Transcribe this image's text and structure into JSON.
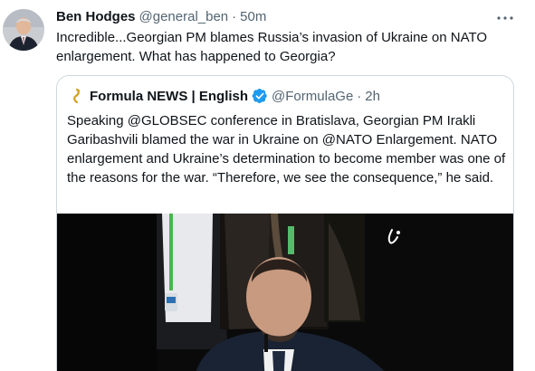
{
  "tweet": {
    "author_name": "Ben Hodges",
    "handle": "@general_ben",
    "separator": "·",
    "time": "50m",
    "text": "Incredible...Georgian PM blames Russia’s invasion of Ukraine on NATO enlargement.  What has happened to Georgia?"
  },
  "quote": {
    "source_name": "Formula NEWS | English",
    "handle": "@FormulaGe",
    "separator": "·",
    "time": "2h",
    "text": "Speaking @GLOBSEC conference in Bratislava, Georgian PM Irakli Garibashvili blamed the war in Ukraine on @NATO Enlargement. NATO enlargement and Ukraine’s determination to become member was one of the reasons for the war. “Therefore, we see the consequence,” he said."
  },
  "icons": {
    "more": "more-horizontal-icon",
    "verified": "verified-badge-icon",
    "source_logo": "formula-logo-icon"
  },
  "colors": {
    "text_primary": "#0f1419",
    "text_secondary": "#536471",
    "border": "#cfd9de",
    "verified": "#1d9bf0",
    "logo": "#d4a020"
  }
}
